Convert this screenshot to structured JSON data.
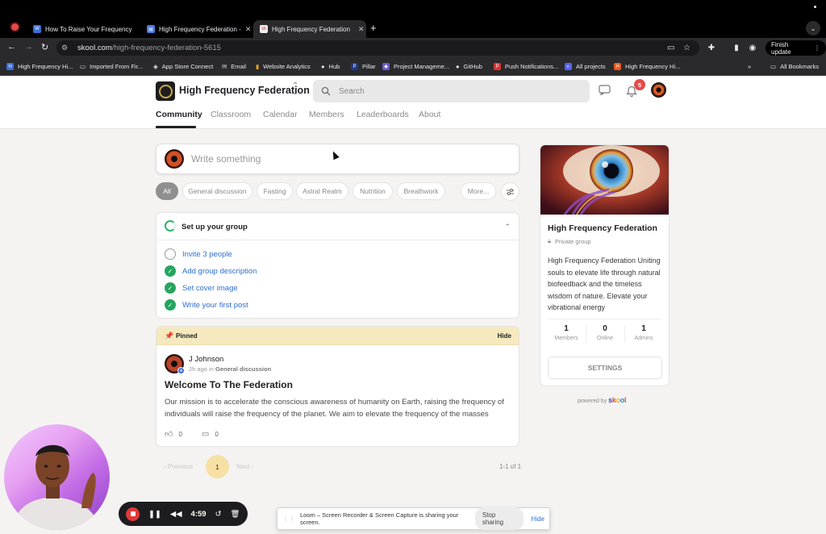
{
  "browser": {
    "tabs": [
      {
        "title": "How To Raise Your Frequency",
        "active": false
      },
      {
        "title": "High Frequency Federation -",
        "active": false
      },
      {
        "title": "High Frequency Federation",
        "active": true
      }
    ],
    "url_host": "skool.com",
    "url_path": "/high-frequency-federation-5615",
    "finish_update": "Finish update",
    "bookmarks": [
      "High Frequency Hi...",
      "Imported From Fir...",
      "App Store Connect",
      "Email",
      "Website Analytics",
      "Hub",
      "Pillar",
      "Project Manageme...",
      "GitHub",
      "Push Notifications...",
      "All projects",
      "High Frequency Hi..."
    ],
    "more_bookmarks": "»",
    "all_bookmarks": "All Bookmarks"
  },
  "header": {
    "group_name": "High Frequency Federation",
    "search_placeholder": "Search",
    "notification_count": "5",
    "nav_tabs": [
      "Community",
      "Classroom",
      "Calendar",
      "Members",
      "Leaderboards",
      "About"
    ],
    "active_tab": "Community"
  },
  "composer": {
    "placeholder": "Write something"
  },
  "filters": {
    "chips": [
      "All",
      "General discussion",
      "Fasting",
      "Astral Realm",
      "Nutrition",
      "Breathwork",
      "More..."
    ],
    "active": "All"
  },
  "setup": {
    "title": "Set up your group",
    "tasks": [
      {
        "label": "Invite 3 people",
        "done": false
      },
      {
        "label": "Add group description",
        "done": true
      },
      {
        "label": "Set cover image",
        "done": true
      },
      {
        "label": "Write your first post",
        "done": true
      }
    ]
  },
  "post": {
    "pinned_label": "Pinned",
    "hide_label": "Hide",
    "author": "J Johnson",
    "time": "2h ago",
    "in_word": "in",
    "category": "General discussion",
    "title": "Welcome To The Federation",
    "body": "Our mission is to accelerate the conscious awareness of humanity on Earth, raising the frequency of individuals will raise the frequency of the planet. We aim to elevate the frequency of the masses",
    "likes": "0",
    "comments": "0"
  },
  "pagination": {
    "prev": "Previous",
    "current": "1",
    "next": "Next",
    "count": "1-1 of 1"
  },
  "group_card": {
    "name": "High Frequency Federation",
    "privacy": "Private group",
    "description": "High Frequency Federation Uniting souls to elevate life through natural biofeedback and the timeless wisdom of nature. Elevate your vibrational energy",
    "stats": [
      {
        "value": "1",
        "label": "Members"
      },
      {
        "value": "0",
        "label": "Online"
      },
      {
        "value": "1",
        "label": "Admins"
      }
    ],
    "settings_label": "SETTINGS",
    "powered_by": "powered by",
    "brand": "skool"
  },
  "loom": {
    "timer": "4:59",
    "sharing_text": "Loom – Screen Recorder & Screen Capture is sharing your screen.",
    "stop_sharing": "Stop sharing",
    "hide": "Hide"
  },
  "colors": {
    "accent_green": "#25a55f",
    "link_blue": "#2e6fd0",
    "pinned_bg": "#f6e9bd",
    "badge_red": "#e44b4b",
    "page_highlight": "#f7e0a4"
  }
}
